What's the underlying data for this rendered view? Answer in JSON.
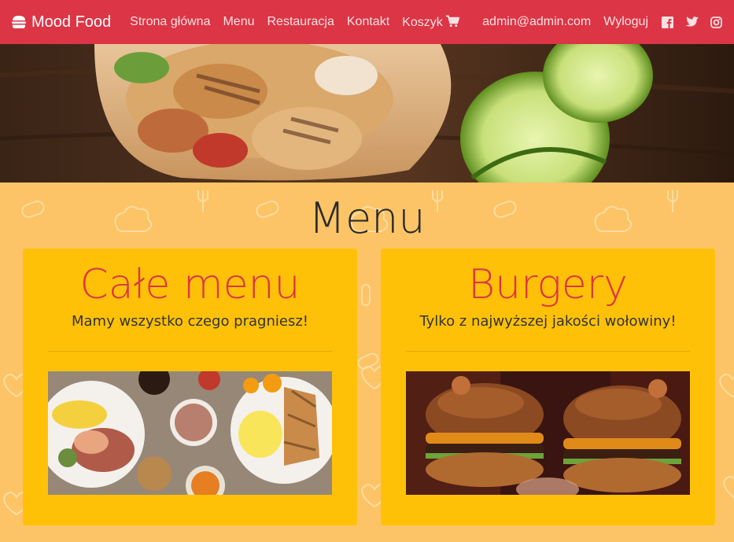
{
  "navbar": {
    "brand": "Mood Food",
    "links": [
      "Strona główna",
      "Menu",
      "Restauracja",
      "Kontakt"
    ],
    "cart_label": "Koszyk",
    "user_email": "admin@admin.com",
    "logout_label": "Wyloguj",
    "social_icons": [
      "facebook-icon",
      "twitter-icon",
      "instagram-icon"
    ]
  },
  "main": {
    "title": "Menu",
    "cards": [
      {
        "title": "Całe menu",
        "subtitle": "Mamy wszystko czego pragniesz!",
        "image": "breakfast-table-photo"
      },
      {
        "title": "Burgery",
        "subtitle": "Tylko z najwyższej jakości wołowiny!",
        "image": "burgers-photo"
      }
    ]
  },
  "colors": {
    "navbar": "#dc3545",
    "card": "#ffc107",
    "page_bg": "#fcc466",
    "accent_title": "#dc3545"
  }
}
